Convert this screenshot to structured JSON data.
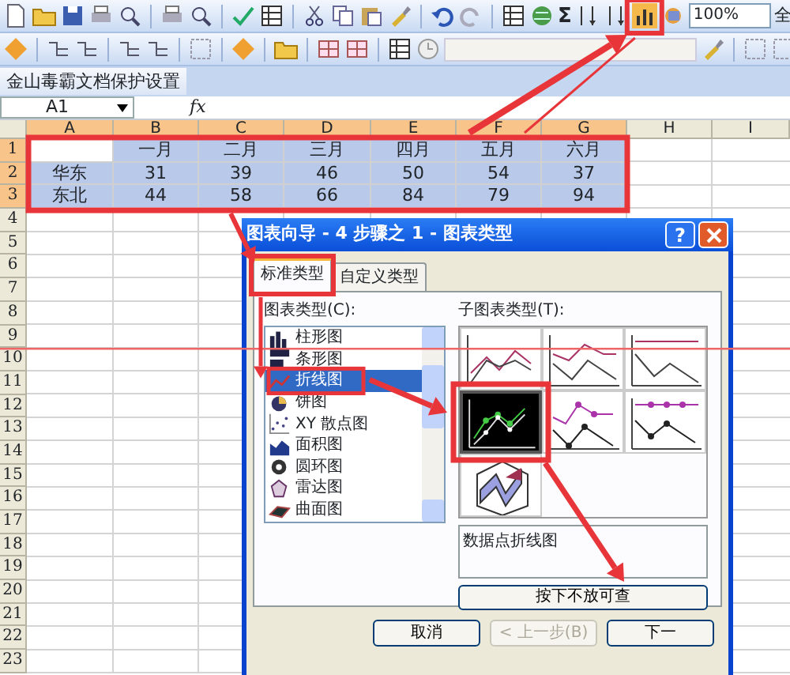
{
  "toolbar": {
    "sum_symbol": "Σ",
    "zoom": "100%",
    "overflow_label": "全"
  },
  "kingsoft_toolbar": {
    "label": "金山毒霸文档保护设置"
  },
  "formula_bar": {
    "name_box": "A1",
    "function_label": "fx"
  },
  "sheet": {
    "columns": [
      {
        "label": "A",
        "selected": true,
        "active": true
      },
      {
        "label": "B",
        "selected": true,
        "active": false
      },
      {
        "label": "C",
        "selected": true,
        "active": false
      },
      {
        "label": "D",
        "selected": true,
        "active": false
      },
      {
        "label": "E",
        "selected": true,
        "active": false
      },
      {
        "label": "F",
        "selected": true,
        "active": false
      },
      {
        "label": "G",
        "selected": true,
        "active": false
      },
      {
        "label": "H",
        "selected": false,
        "active": false
      },
      {
        "label": "I",
        "selected": false,
        "active": false
      }
    ],
    "rows": [
      {
        "label": "1",
        "selected": true,
        "active": true,
        "cells": {
          "B": "一月",
          "C": "二月",
          "D": "三月",
          "E": "四月",
          "F": "五月",
          "G": "六月"
        }
      },
      {
        "label": "2",
        "selected": true,
        "active": false,
        "cells": {
          "A": "华东",
          "B": "31",
          "C": "39",
          "D": "46",
          "E": "50",
          "F": "54",
          "G": "37"
        }
      },
      {
        "label": "3",
        "selected": true,
        "active": false,
        "cells": {
          "A": "东北",
          "B": "44",
          "C": "58",
          "D": "66",
          "E": "84",
          "F": "79",
          "G": "94"
        }
      },
      {
        "label": "4",
        "selected": false,
        "active": false
      },
      {
        "label": "5",
        "selected": false,
        "active": false
      },
      {
        "label": "6",
        "selected": false,
        "active": false
      },
      {
        "label": "7",
        "selected": false,
        "active": false
      },
      {
        "label": "8",
        "selected": false,
        "active": false
      },
      {
        "label": "9",
        "selected": false,
        "active": false
      },
      {
        "label": "10",
        "selected": false,
        "active": false
      },
      {
        "label": "11",
        "selected": false,
        "active": false
      },
      {
        "label": "12",
        "selected": false,
        "active": false
      },
      {
        "label": "13",
        "selected": false,
        "active": false
      },
      {
        "label": "14",
        "selected": false,
        "active": false
      },
      {
        "label": "15",
        "selected": false,
        "active": false
      },
      {
        "label": "16",
        "selected": false,
        "active": false
      },
      {
        "label": "17",
        "selected": false,
        "active": false
      },
      {
        "label": "18",
        "selected": false,
        "active": false
      },
      {
        "label": "19",
        "selected": false,
        "active": false
      },
      {
        "label": "20",
        "selected": false,
        "active": false
      },
      {
        "label": "21",
        "selected": false,
        "active": false
      },
      {
        "label": "22",
        "selected": false,
        "active": false
      },
      {
        "label": "23",
        "selected": false,
        "active": false
      }
    ]
  },
  "dialog": {
    "title": "图表向导 - 4 步骤之 1 - 图表类型",
    "help": "?",
    "tabs": [
      {
        "label": "标准类型",
        "selected": true
      },
      {
        "label": "自定义类型",
        "selected": false
      }
    ],
    "chart_types_label": "图表类型(C):",
    "chart_types": [
      {
        "label": "柱形图",
        "kind": "column",
        "selected": false
      },
      {
        "label": "条形图",
        "kind": "bar",
        "selected": false
      },
      {
        "label": "折线图",
        "kind": "line",
        "selected": true
      },
      {
        "label": "饼图",
        "kind": "pie",
        "selected": false
      },
      {
        "label": "XY 散点图",
        "kind": "scatter",
        "selected": false
      },
      {
        "label": "面积图",
        "kind": "area",
        "selected": false
      },
      {
        "label": "圆环图",
        "kind": "doughnut",
        "selected": false
      },
      {
        "label": "雷达图",
        "kind": "radar",
        "selected": false
      },
      {
        "label": "曲面图",
        "kind": "surface",
        "selected": false
      }
    ],
    "subtypes_label": "子图表类型(T):",
    "subtypes": [
      {
        "kind": "line",
        "selected": false
      },
      {
        "kind": "stacked",
        "selected": false
      },
      {
        "kind": "percent",
        "selected": false
      },
      {
        "kind": "markers",
        "selected": true
      },
      {
        "kind": "stackedmarkers",
        "selected": false
      },
      {
        "kind": "percentmarkers",
        "selected": false
      },
      {
        "kind": "ribbon",
        "selected": false
      }
    ],
    "description": "数据点折线图",
    "preview_button": "按下不放可查",
    "buttons": [
      {
        "label": "取消",
        "disabled": false
      },
      {
        "label": "< 上一步(B)",
        "disabled": true
      },
      {
        "label": "下一",
        "disabled": false
      }
    ]
  }
}
